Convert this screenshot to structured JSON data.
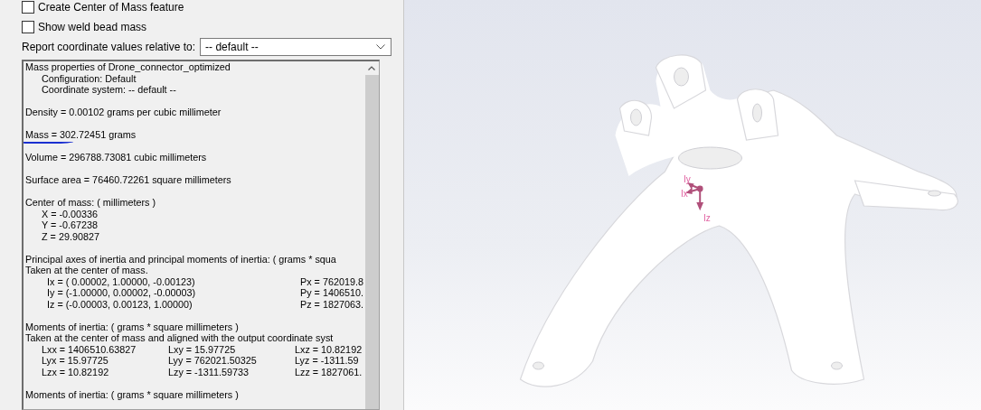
{
  "options": [
    {
      "label": "Create Center of Mass feature",
      "checked": false
    },
    {
      "label": "Show weld bead mass",
      "checked": false
    }
  ],
  "coordinate_select": {
    "label": "Report coordinate values relative to:",
    "value": "-- default --"
  },
  "report": {
    "lines": [
      {
        "kind": "line",
        "text": "Mass properties of Drone_connector_optimized"
      },
      {
        "kind": "sub",
        "text": "Configuration: Default"
      },
      {
        "kind": "sub",
        "text": "Coordinate system: -- default --"
      },
      {
        "kind": "gap"
      },
      {
        "kind": "line",
        "text": "Density = 0.00102 grams per cubic millimeter"
      },
      {
        "kind": "gap"
      },
      {
        "kind": "line",
        "text": "Mass = 302.72451 grams",
        "marked": true
      },
      {
        "kind": "gap"
      },
      {
        "kind": "line",
        "text": "Volume = 296788.73081 cubic millimeters"
      },
      {
        "kind": "gap"
      },
      {
        "kind": "line",
        "text": "Surface area = 76460.72261  square millimeters"
      },
      {
        "kind": "gap"
      },
      {
        "kind": "line",
        "text": "Center of mass: ( millimeters )"
      },
      {
        "kind": "sub",
        "text": "X = -0.00336"
      },
      {
        "kind": "sub",
        "text": "Y = -0.67238"
      },
      {
        "kind": "sub",
        "text": "Z = 29.90827"
      },
      {
        "kind": "gap"
      },
      {
        "kind": "line",
        "text": "Principal axes of inertia and principal moments of inertia: ( grams *  squa"
      },
      {
        "kind": "line",
        "text": "Taken at the center of mass."
      },
      {
        "kind": "axes",
        "cells": [
          "Ix = ( 0.00002,  1.00000, -0.00123)",
          "Px = 762019.8"
        ]
      },
      {
        "kind": "axes",
        "cells": [
          "Iy = (-1.00000,  0.00002, -0.00003)",
          "Py = 1406510."
        ]
      },
      {
        "kind": "axes",
        "cells": [
          "Iz = (-0.00003,  0.00123,  1.00000)",
          "Pz = 1827063."
        ]
      },
      {
        "kind": "gap"
      },
      {
        "kind": "line",
        "text": "Moments of inertia: ( grams *  square millimeters )"
      },
      {
        "kind": "line",
        "text": "Taken at the center of mass and aligned with the output coordinate syst"
      },
      {
        "kind": "row",
        "cells": [
          "Lxx = 1406510.63827",
          "Lxy = 15.97725",
          "Lxz = 10.82192"
        ]
      },
      {
        "kind": "row",
        "cells": [
          "Lyx = 15.97725",
          "Lyy = 762021.50325",
          "Lyz = -1311.59"
        ]
      },
      {
        "kind": "row",
        "cells": [
          "Lzx = 10.82192",
          "Lzy = -1311.59733",
          "Lzz = 1827061."
        ]
      },
      {
        "kind": "gap"
      },
      {
        "kind": "line",
        "text": "Moments of inertia: ( grams *  square millimeters )"
      }
    ]
  },
  "viewport": {
    "axis_labels": [
      "Iy",
      "Ix",
      "Iz"
    ]
  }
}
